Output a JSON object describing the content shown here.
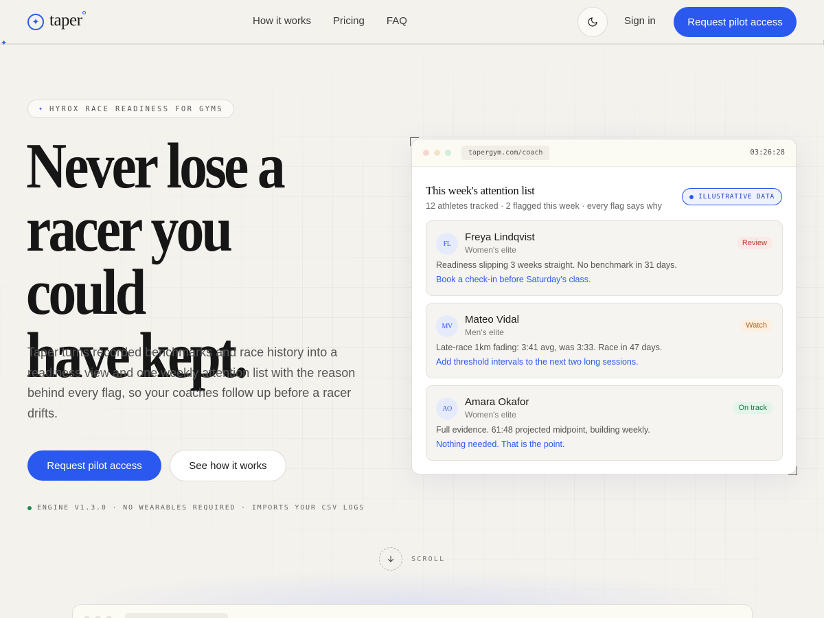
{
  "brand": {
    "name": "taper",
    "accent": "#2b59f0"
  },
  "nav": {
    "links": [
      "How it works",
      "Pricing",
      "FAQ"
    ],
    "signin": "Sign in",
    "cta": "Request pilot access"
  },
  "hero": {
    "eyebrow": "HYROX RACE READINESS FOR GYMS",
    "headline": [
      "Never lose a",
      "racer you could",
      "have kept."
    ],
    "subcopy": "Taper turns recorded benchmarks and race history into a readiness view and one weekly attention list with the reason behind every flag, so your coaches follow up before a racer drifts.",
    "primary_cta": "Request pilot access",
    "secondary_cta": "See how it works",
    "meta": "ENGINE V1.3.0 · NO WEARABLES REQUIRED · IMPORTS YOUR CSV LOGS",
    "scroll_label": "SCROLL"
  },
  "card": {
    "url": "tapergym.com/coach",
    "clock": "03:26:28",
    "title": "This week's attention list",
    "subtitle": "12 athletes tracked · 2 flagged this week · every flag says why",
    "badge": "ILLUSTRATIVE DATA",
    "athletes": [
      {
        "initials": "FL",
        "name": "Freya Lindqvist",
        "division": "Women's elite",
        "status": "Review",
        "status_color": "#c0392b",
        "status_bg": "#fbe9e6",
        "note": "Readiness slipping 3 weeks straight. No benchmark in 31 days.",
        "action": "Book a check-in before Saturday's class."
      },
      {
        "initials": "MV",
        "name": "Mateo Vidal",
        "division": "Men's elite",
        "status": "Watch",
        "status_color": "#b5651d",
        "status_bg": "#fcefe0",
        "note": "Late-race 1km fading: 3:41 avg, was 3:33. Race in 47 days.",
        "action": "Add threshold intervals to the next two long sessions."
      },
      {
        "initials": "AO",
        "name": "Amara Okafor",
        "division": "Women's elite",
        "status": "On track",
        "status_color": "#1f7a45",
        "status_bg": "#e3f4ea",
        "note": "Full evidence. 61:48 projected midpoint, building weekly.",
        "action": "Nothing needed. That is the point."
      }
    ]
  }
}
